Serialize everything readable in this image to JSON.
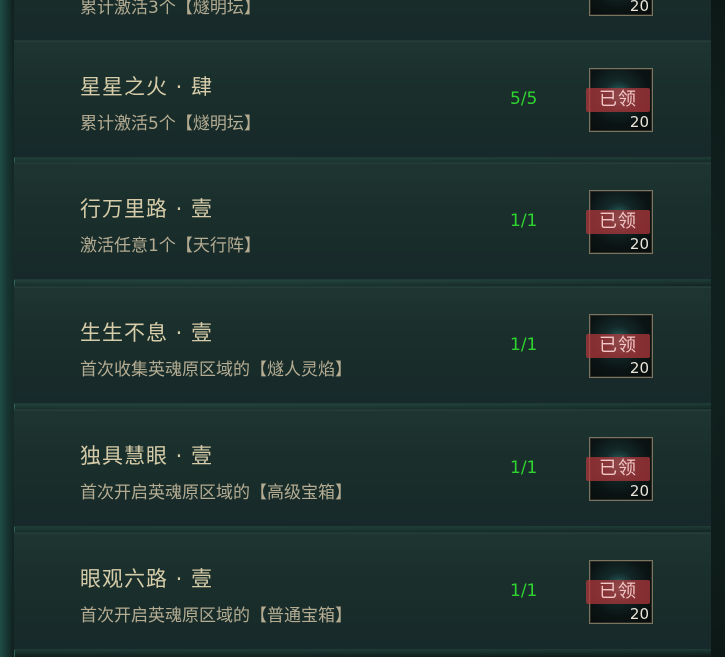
{
  "top_partial": {
    "desc": "累计激活3个【燧明坛】",
    "reward_count": "20"
  },
  "tasks": [
    {
      "title": "星星之火 · 肆",
      "desc": "累计激活5个【燧明坛】",
      "progress": "5/5",
      "status": "已领",
      "reward_count": "20"
    },
    {
      "title": "行万里路 · 壹",
      "desc": "激活任意1个【天行阵】",
      "progress": "1/1",
      "status": "已领",
      "reward_count": "20"
    },
    {
      "title": "生生不息 · 壹",
      "desc": "首次收集英魂原区域的【燧人灵焰】",
      "progress": "1/1",
      "status": "已领",
      "reward_count": "20"
    },
    {
      "title": "独具慧眼 · 壹",
      "desc": "首次开启英魂原区域的【高级宝箱】",
      "progress": "1/1",
      "status": "已领",
      "reward_count": "20"
    },
    {
      "title": "眼观六路 · 壹",
      "desc": "首次开启英魂原区域的【普通宝箱】",
      "progress": "1/1",
      "status": "已领",
      "reward_count": "20"
    }
  ],
  "colors": {
    "progress_complete": "#2fd52f",
    "claimed_stamp": "#b4373c",
    "title_text": "#d6cca9"
  },
  "icons": {
    "reward": "glowing-orb-icon"
  }
}
